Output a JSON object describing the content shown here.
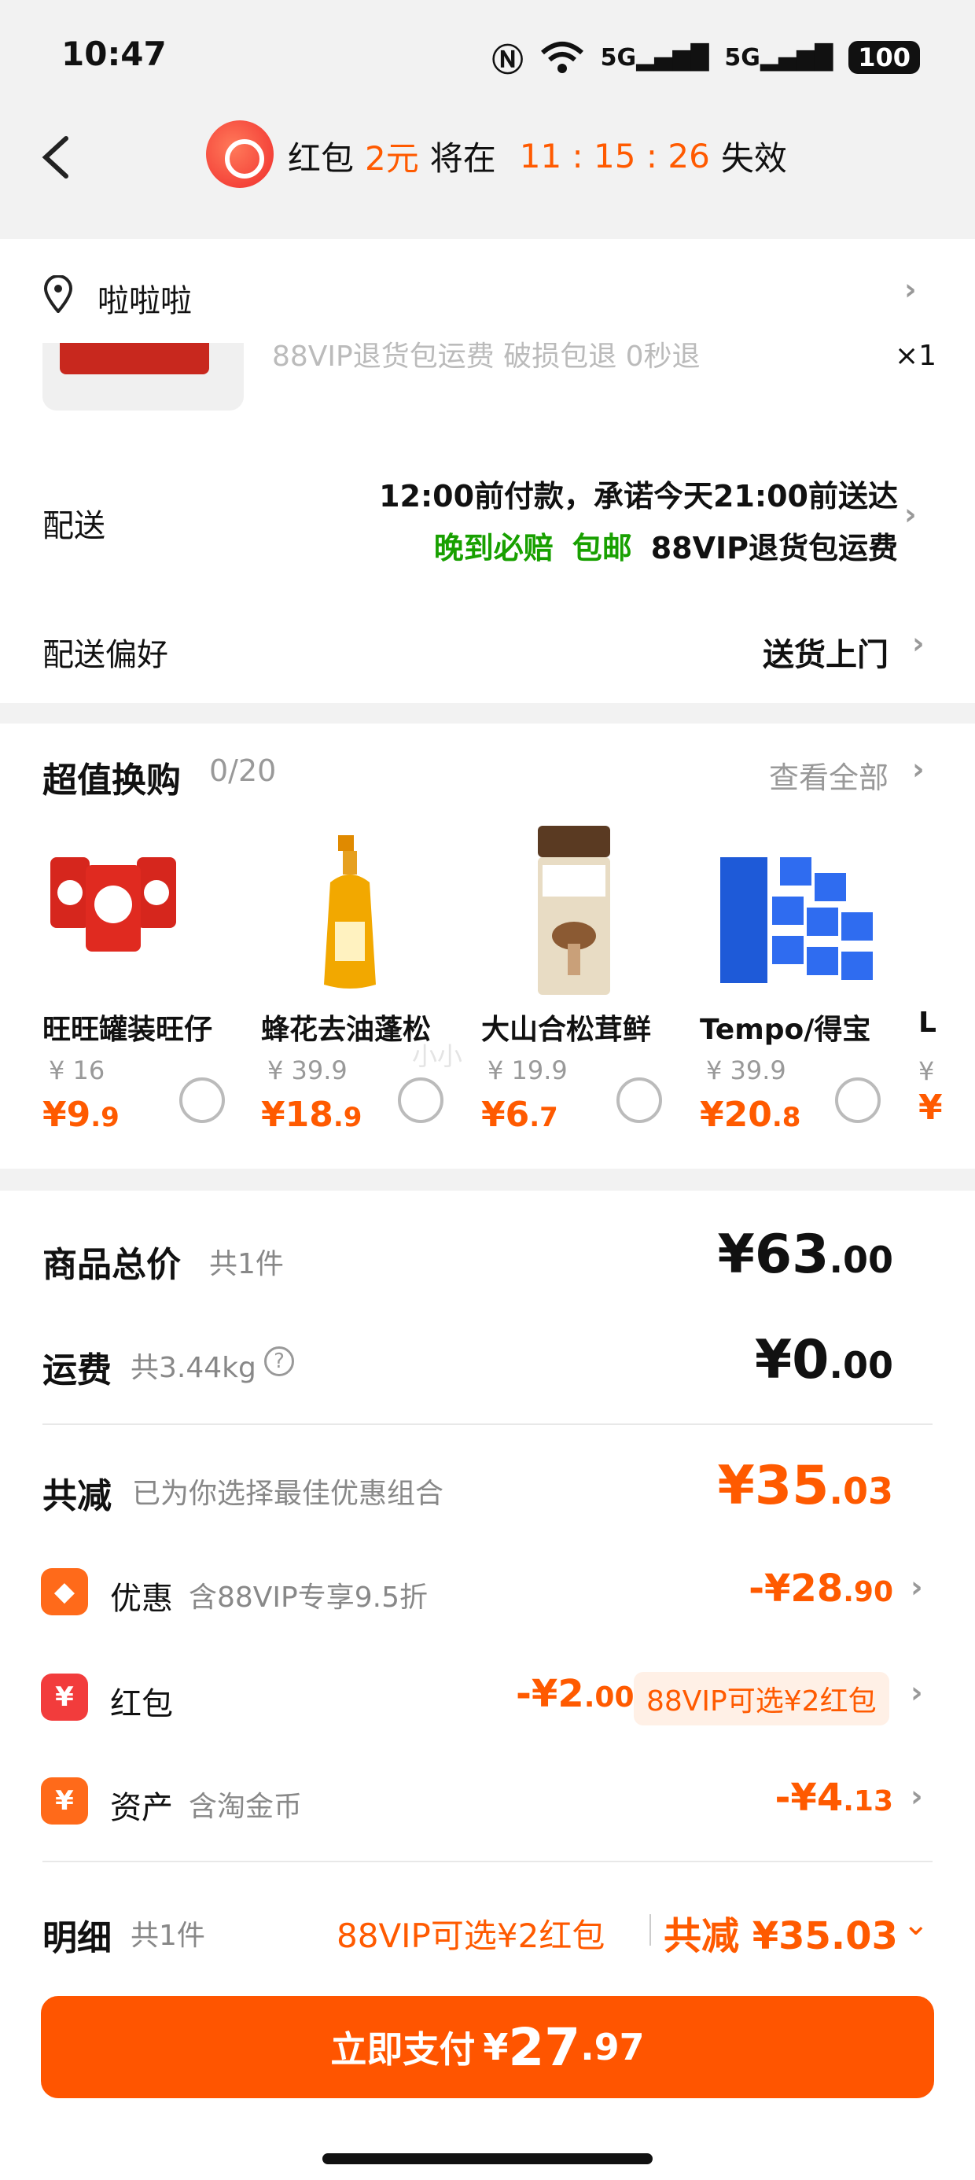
{
  "status_bar": {
    "time": "10:47",
    "net1": "5G",
    "net2": "5G",
    "battery": "100"
  },
  "header": {
    "prefix": "红包",
    "amount": "2元",
    "middle": "将在",
    "countdown": "11 : 15 : 26",
    "suffix": "失效"
  },
  "address": {
    "name": "啦啦啦"
  },
  "item": {
    "tags": "88VIP退货包运费  破损包退  0秒退",
    "qty": "×1"
  },
  "delivery": {
    "label": "配送",
    "line1": "12:00前付款，承诺今天21:00前送达",
    "tag1": "晚到必赔",
    "tag2": "包邮",
    "tag3": "88VIP退货包运费"
  },
  "preference": {
    "label": "配送偏好",
    "value": "送货上门"
  },
  "exchange": {
    "title": "超值换购",
    "count": "0/20",
    "see_all": "查看全部",
    "products": [
      {
        "name": "旺旺罐装旺仔",
        "old": "¥ 16",
        "new_int": "¥9",
        "new_dec": ".9"
      },
      {
        "name": "蜂花去油蓬松",
        "old": "¥ 39.9",
        "new_int": "¥18",
        "new_dec": ".9"
      },
      {
        "name": "大山合松茸鲜",
        "old": "¥ 19.9",
        "new_int": "¥6",
        "new_dec": ".7"
      },
      {
        "name": "Tempo/得宝",
        "old": "¥ 39.9",
        "new_int": "¥20",
        "new_dec": ".8"
      },
      {
        "name": "L",
        "old": "¥",
        "new_int": "¥",
        "new_dec": ""
      }
    ]
  },
  "summary": {
    "total_label": "商品总价",
    "total_sub": "共1件",
    "total_int": "¥63",
    "total_dec": ".00",
    "ship_label": "运费",
    "ship_sub": "共3.44kg",
    "ship_int": "¥0",
    "ship_dec": ".00",
    "reduce_label": "共减",
    "reduce_sub": "已为你选择最佳优惠组合",
    "reduce_int": "¥35",
    "reduce_dec": ".03",
    "discount_label": "优惠",
    "discount_sub": "含88VIP专享9.5折",
    "discount_int": "-¥28",
    "discount_dec": ".90",
    "redpack_label": "红包",
    "redpack_int": "-¥2",
    "redpack_dec": ".00",
    "redpack_pill": "88VIP可选¥2红包",
    "asset_label": "资产",
    "asset_sub": "含淘金币",
    "asset_int": "-¥4",
    "asset_dec": ".13",
    "detail_label": "明细",
    "detail_sub": "共1件",
    "detail_promo": "88VIP可选¥2红包",
    "detail_reduce": "共减 ¥35.03"
  },
  "pay": {
    "label": "立即支付",
    "currency": "¥",
    "int": "27",
    "dec": ".97"
  },
  "watermark": "小小"
}
